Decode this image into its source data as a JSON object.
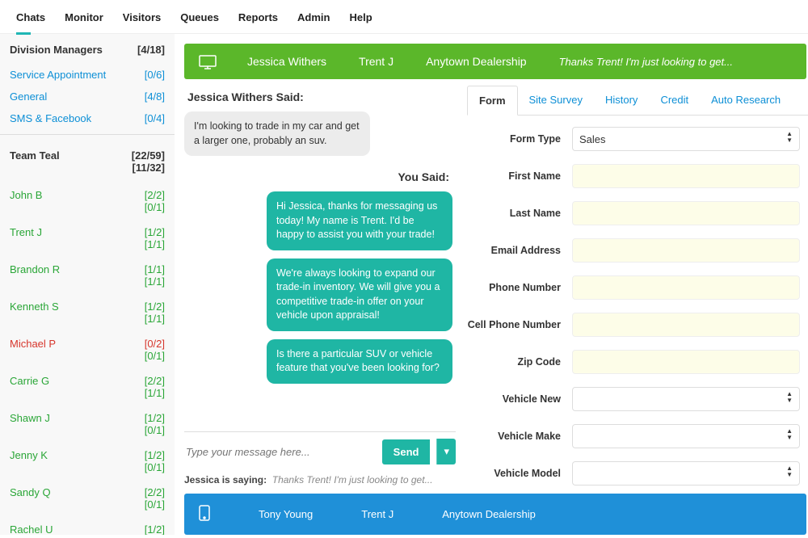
{
  "nav": {
    "items": [
      "Chats",
      "Monitor",
      "Visitors",
      "Queues",
      "Reports",
      "Admin",
      "Help"
    ],
    "activeIndex": 0
  },
  "sidebar": {
    "division": {
      "title": "Division Managers",
      "count": "[4/18]",
      "items": [
        {
          "label": "Service Appointment",
          "count": "[0/6]"
        },
        {
          "label": "General",
          "count": "[4/8]"
        },
        {
          "label": "SMS & Facebook",
          "count": "[0/4]"
        }
      ]
    },
    "team": {
      "title": "Team Teal",
      "count1": "[22/59]",
      "count2": "[11/32]",
      "members": [
        {
          "name": "John B",
          "s1": "[2/2]",
          "s2": "[0/1]",
          "red": false
        },
        {
          "name": "Trent J",
          "s1": "[1/2]",
          "s2": "[1/1]",
          "red": false
        },
        {
          "name": "Brandon R",
          "s1": "[1/1]",
          "s2": "[1/1]",
          "red": false
        },
        {
          "name": "Kenneth S",
          "s1": "[1/2]",
          "s2": "[1/1]",
          "red": false
        },
        {
          "name": "Michael P",
          "s1": "[0/2]",
          "s2": "[0/1]",
          "red": true
        },
        {
          "name": "Carrie G",
          "s1": "[2/2]",
          "s2": "[1/1]",
          "red": false
        },
        {
          "name": "Shawn J",
          "s1": "[1/2]",
          "s2": "[0/1]",
          "red": false
        },
        {
          "name": "Jenny K",
          "s1": "[1/2]",
          "s2": "[0/1]",
          "red": false
        },
        {
          "name": "Sandy Q",
          "s1": "[2/2]",
          "s2": "[0/1]",
          "red": false
        },
        {
          "name": "Rachel U",
          "s1": "[1/2]",
          "s2": "",
          "red": false
        }
      ]
    }
  },
  "activeChat": {
    "customer": "Jessica Withers",
    "agent": "Trent J",
    "dealership": "Anytown Dealership",
    "preview": "Thanks Trent! I'm just looking to get..."
  },
  "chat": {
    "headerIn": "Jessica Withers Said:",
    "msgIn": "I'm looking to trade in my car and get a larger one, probably an suv.",
    "headerOut": "You Said:",
    "msgOut1": "Hi Jessica, thanks for messaging us today! My name is Trent. I'd be happy to assist you with your trade!",
    "msgOut2": "We're always looking to expand our trade-in inventory. We will give you a competitive trade-in offer on your vehicle upon appraisal!",
    "msgOut3": "Is there a particular SUV or vehicle feature that you've been looking for?",
    "composePlaceholder": "Type your message here...",
    "sendLabel": "Send",
    "typingLabel": "Jessica is saying:",
    "typingPreview": "Thanks Trent! I'm just looking to get..."
  },
  "form": {
    "tabs": [
      "Form",
      "Site Survey",
      "History",
      "Credit",
      "Auto Research"
    ],
    "activeIndex": 0,
    "rows": [
      {
        "label": "Form Type",
        "value": "Sales",
        "dropdown": true
      },
      {
        "label": "First Name",
        "value": "",
        "dropdown": false
      },
      {
        "label": "Last Name",
        "value": "",
        "dropdown": false
      },
      {
        "label": "Email Address",
        "value": "",
        "dropdown": false
      },
      {
        "label": "Phone Number",
        "value": "",
        "dropdown": false
      },
      {
        "label": "Cell Phone Number",
        "value": "",
        "dropdown": false
      },
      {
        "label": "Zip Code",
        "value": "",
        "dropdown": false
      },
      {
        "label": "Vehicle New",
        "value": "",
        "dropdown": true
      },
      {
        "label": "Vehicle Make",
        "value": "",
        "dropdown": true
      },
      {
        "label": "Vehicle Model",
        "value": "",
        "dropdown": true
      }
    ]
  },
  "queuedChat": {
    "customer": "Tony Young",
    "agent": "Trent J",
    "dealership": "Anytown Dealership"
  }
}
